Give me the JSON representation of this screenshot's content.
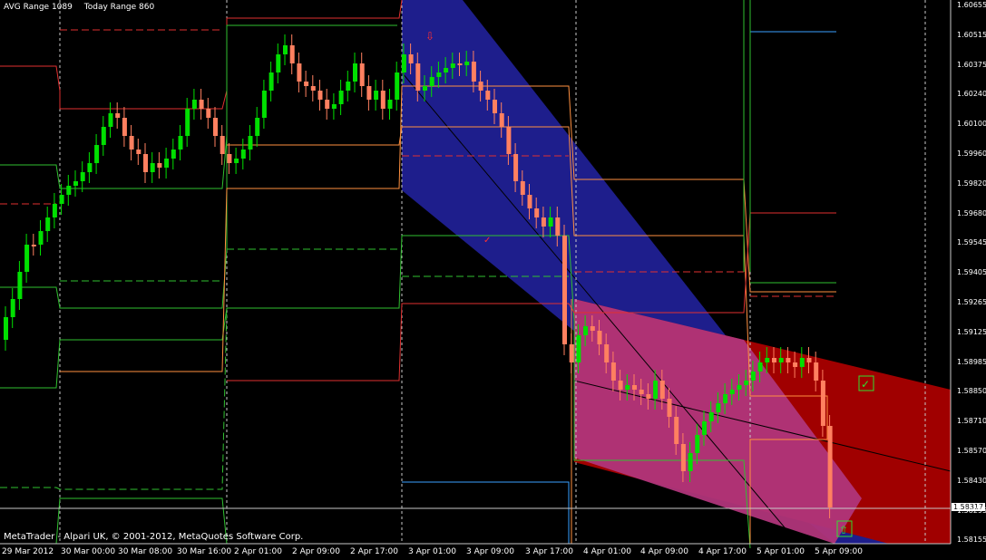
{
  "header": {
    "avg_range": "AVG Range 1089",
    "today_range": "Today Range 860"
  },
  "copyright": "MetaTrader - Alpari UK, © 2001-2012, MetaQuotes Software Corp.",
  "current_price": "1.58317",
  "price_axis": [
    "1.60655",
    "1.60515",
    "1.60375",
    "1.60240",
    "1.60100",
    "1.59960",
    "1.59820",
    "1.59680",
    "1.59545",
    "1.59405",
    "1.59265",
    "1.59125",
    "1.58985",
    "1.58850",
    "1.58710",
    "1.58570",
    "1.58430",
    "1.58295",
    "1.58155"
  ],
  "time_axis": [
    "29 Mar 2012",
    "30 Mar 00:00",
    "30 Mar 08:00",
    "30 Mar 16:00",
    "2 Apr 01:00",
    "2 Apr 09:00",
    "2 Apr 17:00",
    "3 Apr 01:00",
    "3 Apr 09:00",
    "3 Apr 17:00",
    "4 Apr 01:00",
    "4 Apr 09:00",
    "4 Apr 17:00",
    "5 Apr 01:00",
    "5 Apr 09:00"
  ],
  "colors": {
    "bull": "#00e000",
    "bear": "#ff8060",
    "channel_blue": "#1e1e8c",
    "channel_red": "#a00000",
    "channel_magenta": "#b0357a",
    "grid": "#c0c0c0"
  },
  "icons": {
    "down_arrow": "down-arrow-icon",
    "up_arrow": "up-arrow-icon",
    "check": "check-icon"
  }
}
